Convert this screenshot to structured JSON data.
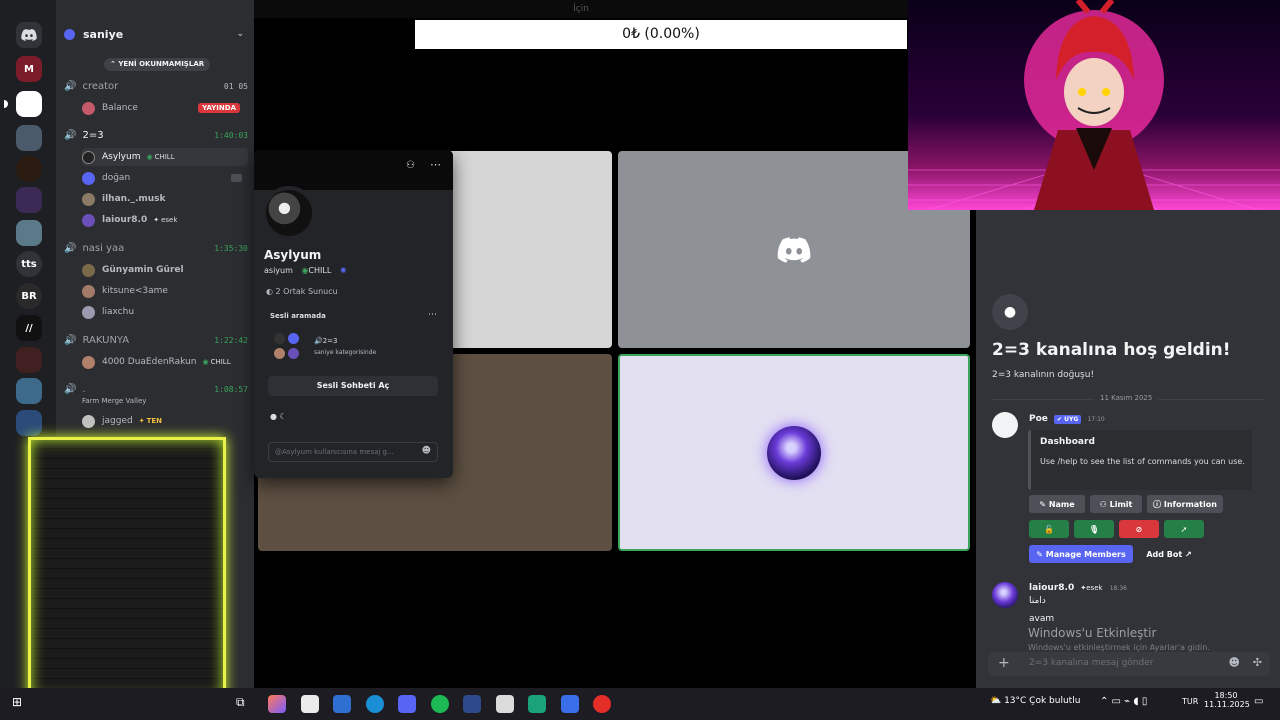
{
  "server": {
    "name": "saniye",
    "unread_banner": "YENİ OKUNMAMIŞLAR"
  },
  "channels": [
    {
      "name": "creator",
      "time": "01 05",
      "users": [
        {
          "name": "Balance",
          "badge": "YAYINDA"
        }
      ]
    },
    {
      "name": "2=3",
      "time": "1:40:03",
      "users": [
        {
          "name": "Asylyum",
          "tag": "CHILL"
        },
        {
          "name": "doğan",
          "tag": ""
        },
        {
          "name": "ilhan._.musk",
          "tag": ""
        },
        {
          "name": "laiour8.0",
          "tag": "esek"
        }
      ]
    },
    {
      "name": "nasi yaa",
      "time": "1:35:30",
      "users": [
        {
          "name": "Günyamin Gürel",
          "tag": ""
        },
        {
          "name": "kitsune<3ame",
          "tag": ""
        },
        {
          "name": "liaxchu",
          "tag": ""
        }
      ]
    },
    {
      "name": "RAKUNYA",
      "time": "1:22:42",
      "users": [
        {
          "name": "4000 DuaEdenRakun",
          "tag": "CHILL"
        }
      ]
    },
    {
      "name": ".",
      "time": "1:08:57",
      "subtitle": "Farm Merge Valley",
      "users": [
        {
          "name": "jagged",
          "tag": "TEN"
        }
      ]
    }
  ],
  "top": {
    "title": "İçin",
    "ticker": "0₺ (0.00%)"
  },
  "profile": {
    "display_name": "Asylyum",
    "username": "asiyum",
    "tag": "CHILL",
    "mutual": "2 Ortak Sunucu",
    "voice_label": "Sesli aramada",
    "voice_channel": "2=3",
    "voice_category": "saniye kategorisinde",
    "button": "Sesli Sohbeti Aç",
    "message_placeholder": "@Asylyum kullanıcısına mesaj g..."
  },
  "chat": {
    "welcome_title": "2=3 kanalına hoş geldin!",
    "welcome_sub": "2=3 kanalının doğuşu!",
    "date_divider": "11 Kasım 2025",
    "bot_name": "Poe",
    "bot_tag": "UYG",
    "bot_time": "17:10",
    "embed_title": "Dashboard",
    "embed_text": "Use /help to see the list of commands you can use.",
    "buttons": {
      "name": "Name",
      "limit": "Limit",
      "information": "Information",
      "manage": "Manage Members",
      "add_bot": "Add Bot"
    },
    "msg_author": "laiour8.0",
    "msg_tag": "esek",
    "msg_time": "18:36",
    "msg_lines": [
      "دامنا",
      "avam"
    ],
    "activation_title": "Windows'u Etkinleştir",
    "activation_sub": "Windows'u etkinleştirmek için Ayarlar'a gidin.",
    "input_placeholder": "2=3 kanalına mesaj gönder"
  },
  "taskbar": {
    "weather": "13°C  Çok bulutlu",
    "lang": "TUR",
    "time": "18:50",
    "date": "11.11.2025"
  },
  "colors": {
    "accent": "#5865f2",
    "green": "#248046",
    "red": "#da373c",
    "neon": "#e9f04a"
  }
}
